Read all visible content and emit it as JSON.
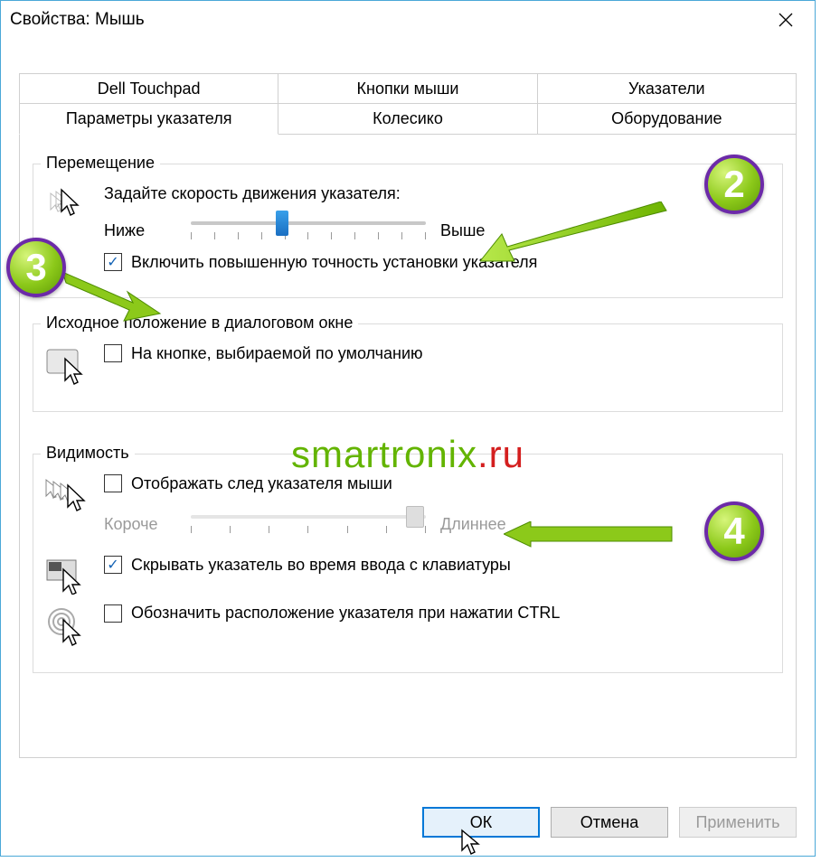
{
  "window": {
    "title": "Свойства: Мышь"
  },
  "tabs": {
    "row1": [
      {
        "label": "Dell Touchpad"
      },
      {
        "label": "Кнопки мыши"
      },
      {
        "label": "Указатели"
      }
    ],
    "row2": [
      {
        "label": "Параметры указателя",
        "active": true
      },
      {
        "label": "Колесико"
      },
      {
        "label": "Оборудование"
      }
    ]
  },
  "groups": {
    "motion": {
      "legend": "Перемещение",
      "instruction": "Задайте скорость движения указателя:",
      "low": "Ниже",
      "high": "Выше",
      "precision": "Включить повышенную точность установки указателя"
    },
    "snap": {
      "legend": "Исходное положение в диалоговом окне",
      "default_button": "На кнопке, выбираемой по умолчанию"
    },
    "visibility": {
      "legend": "Видимость",
      "trails": "Отображать след указателя мыши",
      "short": "Короче",
      "long": "Длиннее",
      "hide_typing": "Скрывать указатель во время ввода с клавиатуры",
      "ctrl_locate": "Обозначить расположение указателя при нажатии CTRL"
    }
  },
  "buttons": {
    "ok": "ОК",
    "cancel": "Отмена",
    "apply": "Применить"
  },
  "annotations": {
    "b2": "2",
    "b3": "3",
    "b4": "4"
  },
  "watermark": {
    "part1": "smartronix",
    "part2": ".ru"
  }
}
